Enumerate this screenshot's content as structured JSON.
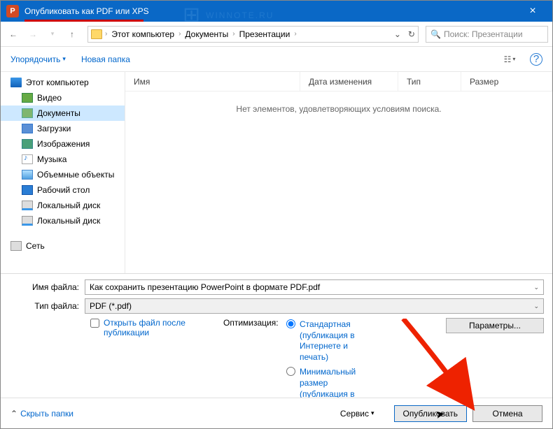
{
  "titlebar": {
    "title": "Опубликовать как PDF или XPS"
  },
  "watermark": "WINNOTE.RU",
  "nav": {
    "crumbs": [
      "Этот компьютер",
      "Документы",
      "Презентации"
    ],
    "search_placeholder": "Поиск: Презентации"
  },
  "toolbar": {
    "organize": "Упорядочить",
    "new_folder": "Новая папка"
  },
  "tree": {
    "items": [
      {
        "label": "Этот компьютер",
        "icon": "pc"
      },
      {
        "label": "Видео",
        "icon": "video"
      },
      {
        "label": "Документы",
        "icon": "docs",
        "selected": true
      },
      {
        "label": "Загрузки",
        "icon": "down"
      },
      {
        "label": "Изображения",
        "icon": "img"
      },
      {
        "label": "Музыка",
        "icon": "music"
      },
      {
        "label": "Объемные объекты",
        "icon": "vol"
      },
      {
        "label": "Рабочий стол",
        "icon": "desk"
      },
      {
        "label": "Локальный диск",
        "icon": "disk"
      },
      {
        "label": "Локальный диск",
        "icon": "disk"
      }
    ],
    "network": "Сеть"
  },
  "columns": {
    "name": "Имя",
    "date": "Дата изменения",
    "type": "Тип",
    "size": "Размер"
  },
  "empty": "Нет элементов, удовлетворяющих условиям поиска.",
  "fields": {
    "filename_label": "Имя файла:",
    "filename_value": "Как сохранить презентацию PowerPoint в формате PDF.pdf",
    "filetype_label": "Тип файла:",
    "filetype_value": "PDF (*.pdf)"
  },
  "options": {
    "open_after": "Открыть файл после публикации",
    "optimize_label": "Оптимизация:",
    "standard": "Стандартная (публикация в Интернете и печать)",
    "minimal": "Минимальный размер (публикация в Интернете)",
    "params": "Параметры..."
  },
  "footer": {
    "hide": "Скрыть папки",
    "tools": "Сервис",
    "publish": "Опубликовать",
    "cancel": "Отмена"
  }
}
